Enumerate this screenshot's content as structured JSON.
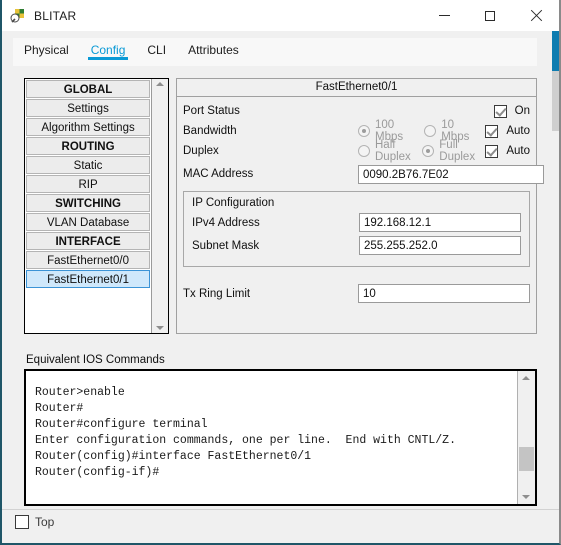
{
  "window": {
    "title": "BLITAR",
    "icon": "packet-tracer-icon",
    "minimize_label": "Minimize",
    "maximize_label": "Maximize",
    "close_label": "Close",
    "accent_color": "#0e7cb0"
  },
  "tabs": [
    {
      "label": "Physical",
      "active": false
    },
    {
      "label": "Config",
      "active": true
    },
    {
      "label": "CLI",
      "active": false
    },
    {
      "label": "Attributes",
      "active": false
    }
  ],
  "sidebar": {
    "items": [
      {
        "label": "GLOBAL",
        "type": "header",
        "selected": false
      },
      {
        "label": "Settings",
        "type": "item",
        "selected": false
      },
      {
        "label": "Algorithm Settings",
        "type": "item",
        "selected": false
      },
      {
        "label": "ROUTING",
        "type": "header",
        "selected": false
      },
      {
        "label": "Static",
        "type": "item",
        "selected": false
      },
      {
        "label": "RIP",
        "type": "item",
        "selected": false
      },
      {
        "label": "SWITCHING",
        "type": "header",
        "selected": false
      },
      {
        "label": "VLAN Database",
        "type": "item",
        "selected": false
      },
      {
        "label": "INTERFACE",
        "type": "header",
        "selected": false
      },
      {
        "label": "FastEthernet0/0",
        "type": "item",
        "selected": false
      },
      {
        "label": "FastEthernet0/1",
        "type": "item",
        "selected": true
      }
    ],
    "scroll_up": "scroll-up-icon",
    "scroll_down": "scroll-down-icon"
  },
  "config": {
    "panel_title": "FastEthernet0/1",
    "port_status": {
      "label": "Port Status",
      "on_label": "On",
      "checked": true
    },
    "bandwidth": {
      "label": "Bandwidth",
      "option_100": "100 Mbps",
      "option_10": "10 Mbps",
      "selected": "100 Mbps",
      "auto_label": "Auto",
      "auto_checked": true
    },
    "duplex": {
      "label": "Duplex",
      "option_half": "Half Duplex",
      "option_full": "Full Duplex",
      "selected": "Full Duplex",
      "auto_label": "Auto",
      "auto_checked": true
    },
    "mac_address": {
      "label": "MAC Address",
      "value": "0090.2B76.7E02"
    },
    "ip_configuration": {
      "legend": "IP Configuration",
      "ipv4_label": "IPv4 Address",
      "ipv4_value": "192.168.12.1",
      "subnet_label": "Subnet Mask",
      "subnet_value": "255.255.252.0"
    },
    "tx_ring_limit": {
      "label": "Tx Ring Limit",
      "value": "10"
    }
  },
  "ios": {
    "label": "Equivalent IOS Commands",
    "text": "Router>enable\nRouter#\nRouter#configure terminal\nEnter configuration commands, one per line.  End with CNTL/Z.\nRouter(config)#interface FastEthernet0/1\nRouter(config-if)#"
  },
  "bottom": {
    "top_label": "Top",
    "top_checked": false
  }
}
